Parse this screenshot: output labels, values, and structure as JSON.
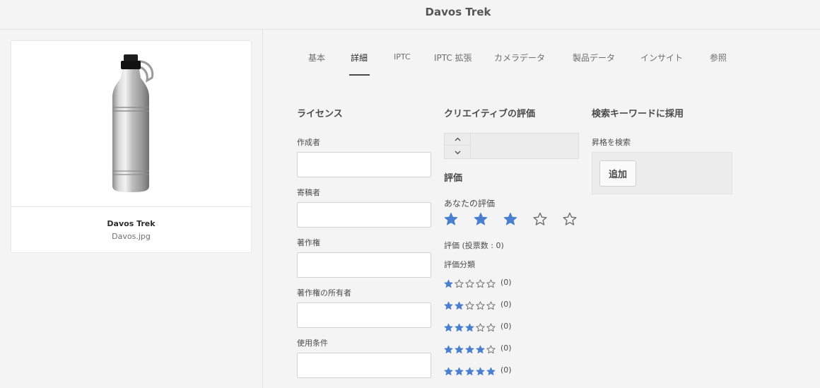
{
  "header": {
    "title": "Davos Trek"
  },
  "asset": {
    "name": "Davos Trek",
    "filename": "Davos.jpg"
  },
  "tabs": [
    {
      "label": "基本"
    },
    {
      "label": "詳細",
      "active": true
    },
    {
      "label": "IPTC"
    },
    {
      "label": "IPTC 拡張"
    },
    {
      "label": "カメラデータ"
    },
    {
      "label": "製品データ"
    },
    {
      "label": "インサイト"
    },
    {
      "label": "参照"
    }
  ],
  "license": {
    "title": "ライセンス",
    "fields": [
      {
        "label": "作成者",
        "value": ""
      },
      {
        "label": "寄稿者",
        "value": ""
      },
      {
        "label": "著作権",
        "value": ""
      },
      {
        "label": "著作権の所有者",
        "value": ""
      },
      {
        "label": "使用条件",
        "value": ""
      }
    ]
  },
  "creative_rating": {
    "title": "クリエイティブの評価",
    "stepper_value": "",
    "rating_title": "評価",
    "your_rating_label": "あなたの評価",
    "your_rating": 3,
    "your_rating_max": 5,
    "rating_summary": "評価 (投票数 : 0)",
    "distribution_label": "評価分類",
    "distribution": [
      {
        "stars": 1,
        "count": "(0)"
      },
      {
        "stars": 2,
        "count": "(0)"
      },
      {
        "stars": 3,
        "count": "(0)"
      },
      {
        "stars": 4,
        "count": "(0)"
      },
      {
        "stars": 5,
        "count": "(0)"
      }
    ]
  },
  "search_keywords": {
    "title": "検索キーワードに採用",
    "field_label": "昇格を検索",
    "add_button": "追加"
  },
  "colors": {
    "star": "#4a7fd0",
    "star_empty": "#6e6e6e"
  }
}
